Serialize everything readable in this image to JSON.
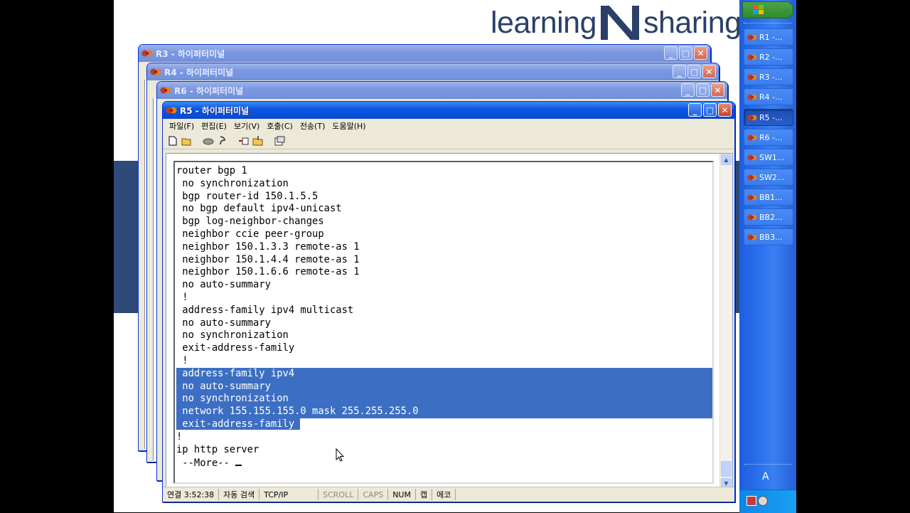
{
  "logo": {
    "left_text": "learning",
    "right_text": "sharing"
  },
  "windows": {
    "background": [
      {
        "title": "R3 - 하이퍼터미널"
      },
      {
        "title": "R4 - 하이퍼터미널"
      },
      {
        "title": "R6 - 하이퍼터미널"
      }
    ],
    "active": {
      "title": "R5 - 하이퍼터미널",
      "menu": [
        "파일(F)",
        "편집(E)",
        "보기(V)",
        "호출(C)",
        "전송(T)",
        "도움말(H)"
      ],
      "toolbar_icons": [
        "new-icon",
        "open-icon",
        "disconnect-icon",
        "dial-icon",
        "send-file-icon",
        "receive-file-icon",
        "properties-icon"
      ],
      "terminal_lines": [
        "router bgp 1",
        " no synchronization",
        " bgp router-id 150.1.5.5",
        " no bgp default ipv4-unicast",
        " bgp log-neighbor-changes",
        " neighbor ccie peer-group",
        " neighbor 150.1.3.3 remote-as 1",
        " neighbor 150.1.4.4 remote-as 1",
        " neighbor 150.1.6.6 remote-as 1",
        " no auto-summary",
        " !",
        " address-family ipv4 multicast",
        " no auto-summary",
        " no synchronization",
        " exit-address-family",
        " !",
        " address-family ipv4",
        " no auto-summary",
        " no synchronization",
        " network 155.155.155.0 mask 255.255.255.0",
        " exit-address-family",
        "!",
        "ip http server",
        " --More-- "
      ],
      "status": {
        "connected": "연결 3:52:38",
        "detect": "자동 검색",
        "protocol": "TCP/IP",
        "scroll": "SCROLL",
        "caps": "CAPS",
        "num": "NUM",
        "capture": "캡",
        "echo": "에코"
      }
    }
  },
  "taskbar": {
    "buttons": [
      "R1 -...",
      "R2 -...",
      "R3 -...",
      "R4 -...",
      "R5 -...",
      "R6 -...",
      "SW1...",
      "SW2...",
      "BB1...",
      "BB2...",
      "BB3..."
    ],
    "active_index": 4,
    "language_indicator": "A"
  }
}
